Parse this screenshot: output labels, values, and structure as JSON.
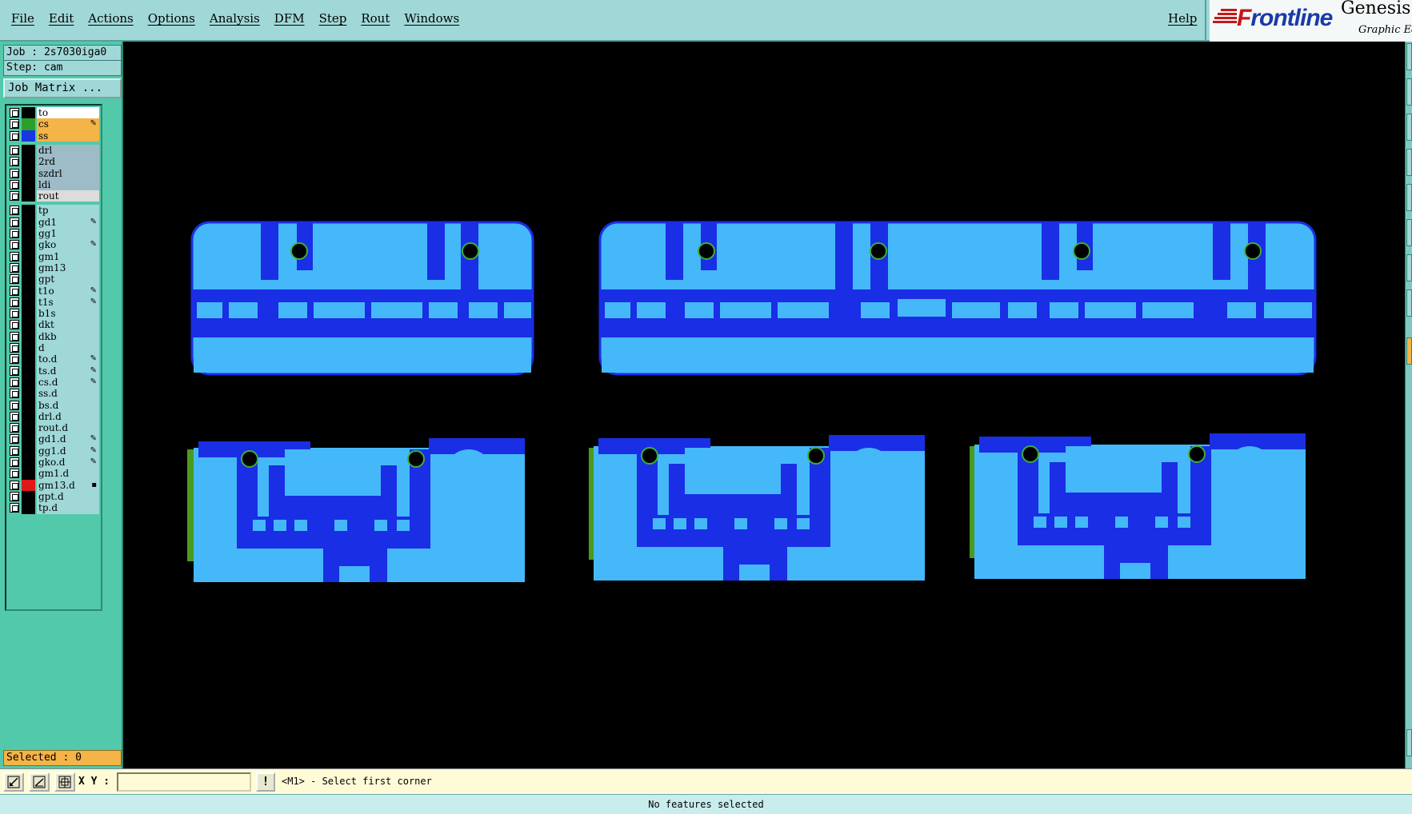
{
  "menubar": {
    "items": [
      "File",
      "Edit",
      "Actions",
      "Options",
      "Analysis",
      "DFM",
      "Step",
      "Rout",
      "Windows"
    ],
    "help": "Help"
  },
  "logo": {
    "brand_prefix": "F",
    "brand_rest": "rontline",
    "product": "Genesis",
    "subtitle": "Graphic Ed"
  },
  "job": {
    "job_label": "Job : 2s7030iga0",
    "step_label": "Step: cam",
    "matrix_button": "Job Matrix ..."
  },
  "layers": [
    {
      "name": "to",
      "color": "#000000",
      "name_bg": "#ffffff",
      "flag": ""
    },
    {
      "name": "cs",
      "color": "#2aa02a",
      "name_bg": "#f5b447",
      "flag": "✎"
    },
    {
      "name": "ss",
      "color": "#1a36e0",
      "name_bg": "#f5b447",
      "flag": ""
    },
    {
      "name": "drl",
      "color": "#000000",
      "name_bg": "#9ebcc8",
      "flag": ""
    },
    {
      "name": "2rd",
      "color": "#000000",
      "name_bg": "#9ebcc8",
      "flag": ""
    },
    {
      "name": "szdrl",
      "color": "#000000",
      "name_bg": "#9ebcc8",
      "flag": ""
    },
    {
      "name": "ldi",
      "color": "#000000",
      "name_bg": "#9ebcc8",
      "flag": ""
    },
    {
      "name": "rout",
      "color": "#000000",
      "name_bg": "#dcdcdc",
      "flag": ""
    },
    {
      "name": "tp",
      "color": "#000000",
      "name_bg": "#a0d8d8",
      "flag": ""
    },
    {
      "name": "gd1",
      "color": "#000000",
      "name_bg": "#a0d8d8",
      "flag": "✎"
    },
    {
      "name": "gg1",
      "color": "#000000",
      "name_bg": "#a0d8d8",
      "flag": ""
    },
    {
      "name": "gko",
      "color": "#000000",
      "name_bg": "#a0d8d8",
      "flag": "✎"
    },
    {
      "name": "gm1",
      "color": "#000000",
      "name_bg": "#a0d8d8",
      "flag": ""
    },
    {
      "name": "gm13",
      "color": "#000000",
      "name_bg": "#a0d8d8",
      "flag": ""
    },
    {
      "name": "gpt",
      "color": "#000000",
      "name_bg": "#a0d8d8",
      "flag": ""
    },
    {
      "name": "t1o",
      "color": "#000000",
      "name_bg": "#a0d8d8",
      "flag": "✎"
    },
    {
      "name": "t1s",
      "color": "#000000",
      "name_bg": "#a0d8d8",
      "flag": "✎"
    },
    {
      "name": "b1s",
      "color": "#000000",
      "name_bg": "#a0d8d8",
      "flag": ""
    },
    {
      "name": "dkt",
      "color": "#000000",
      "name_bg": "#a0d8d8",
      "flag": ""
    },
    {
      "name": "dkb",
      "color": "#000000",
      "name_bg": "#a0d8d8",
      "flag": ""
    },
    {
      "name": "d",
      "color": "#000000",
      "name_bg": "#a0d8d8",
      "flag": ""
    },
    {
      "name": "to.d",
      "color": "#000000",
      "name_bg": "#a0d8d8",
      "flag": "✎"
    },
    {
      "name": "ts.d",
      "color": "#000000",
      "name_bg": "#a0d8d8",
      "flag": "✎"
    },
    {
      "name": "cs.d",
      "color": "#000000",
      "name_bg": "#a0d8d8",
      "flag": "✎"
    },
    {
      "name": "ss.d",
      "color": "#000000",
      "name_bg": "#a0d8d8",
      "flag": ""
    },
    {
      "name": "bs.d",
      "color": "#000000",
      "name_bg": "#a0d8d8",
      "flag": ""
    },
    {
      "name": "drl.d",
      "color": "#000000",
      "name_bg": "#a0d8d8",
      "flag": ""
    },
    {
      "name": "rout.d",
      "color": "#000000",
      "name_bg": "#a0d8d8",
      "flag": ""
    },
    {
      "name": "gd1.d",
      "color": "#000000",
      "name_bg": "#a0d8d8",
      "flag": "✎"
    },
    {
      "name": "gg1.d",
      "color": "#000000",
      "name_bg": "#a0d8d8",
      "flag": "✎"
    },
    {
      "name": "gko.d",
      "color": "#000000",
      "name_bg": "#a0d8d8",
      "flag": "✎"
    },
    {
      "name": "gm1.d",
      "color": "#000000",
      "name_bg": "#a0d8d8",
      "flag": ""
    },
    {
      "name": "gm13.d",
      "color": "#e01818",
      "name_bg": "#a0d8d8",
      "flag": "▪"
    },
    {
      "name": "gpt.d",
      "color": "#000000",
      "name_bg": "#a0d8d8",
      "flag": ""
    },
    {
      "name": "tp.d",
      "color": "#000000",
      "name_bg": "#a0d8d8",
      "flag": ""
    }
  ],
  "selected_label": "Selected : 0",
  "command": {
    "xy_label": "X Y :",
    "xy_value": "",
    "bang": "!",
    "prompt": "<M1> - Select first corner"
  },
  "status": "No features selected",
  "colors": {
    "board_light": "#45b8fa",
    "board_dark": "#1a2ee6",
    "board_edge": "#4a9a20",
    "pad_outline": "#3ab03a"
  }
}
